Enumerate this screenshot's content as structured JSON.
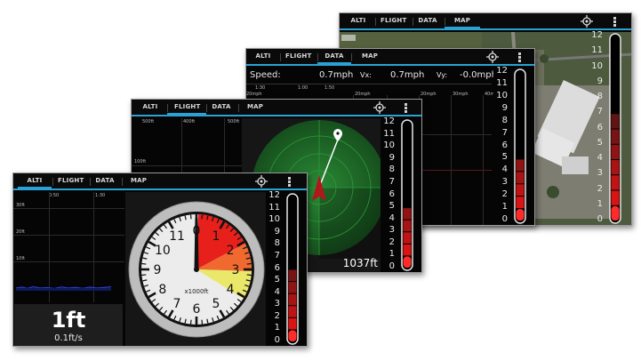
{
  "tabs": [
    "ALTI",
    "FLIGHT",
    "DATA",
    "MAP"
  ],
  "scale_labels": [
    "12",
    "11",
    "10",
    "9",
    "8",
    "7",
    "6",
    "5",
    "4",
    "3",
    "2",
    "1",
    "0"
  ],
  "colors": {
    "accent": "#2aa2d6",
    "bar_red": "#e01e1e",
    "radar_green": "#1f6e28"
  },
  "map": {
    "icons": [
      "gps-target-icon",
      "overflow-menu-icon"
    ],
    "scale_levels": 7
  },
  "data": {
    "speed_label": "Speed:",
    "speed_value": "0.7mph",
    "vx_label": "Vx:",
    "vx_value": "0.7mph",
    "vy_label": "Vy:",
    "vy_value": "-0.0mph",
    "time_ticks": [
      "1:30",
      "1:00",
      "1:50"
    ],
    "speed_ticks": [
      "20mph",
      "20mph",
      "20mph",
      "30mph",
      "40mph"
    ],
    "scale_levels": 5
  },
  "flight": {
    "grid_top_labels": [
      "500ft",
      "400ft",
      "500ft"
    ],
    "grid_side_label": "100ft",
    "altitude_readout": "1037ft",
    "scale_levels": 5
  },
  "alti": {
    "time_ticks": [
      "0:50",
      "1:30"
    ],
    "alt_ticks": [
      "30ft",
      "20ft",
      "10ft"
    ],
    "altitude_value": "1ft",
    "vertical_speed": "0.1ft/s",
    "dial_numbers": [
      "0",
      "1",
      "2",
      "3",
      "4",
      "5",
      "6",
      "7",
      "8",
      "9",
      "10",
      "11"
    ],
    "dial_unit": "x1000ft",
    "scale_levels": 6
  }
}
